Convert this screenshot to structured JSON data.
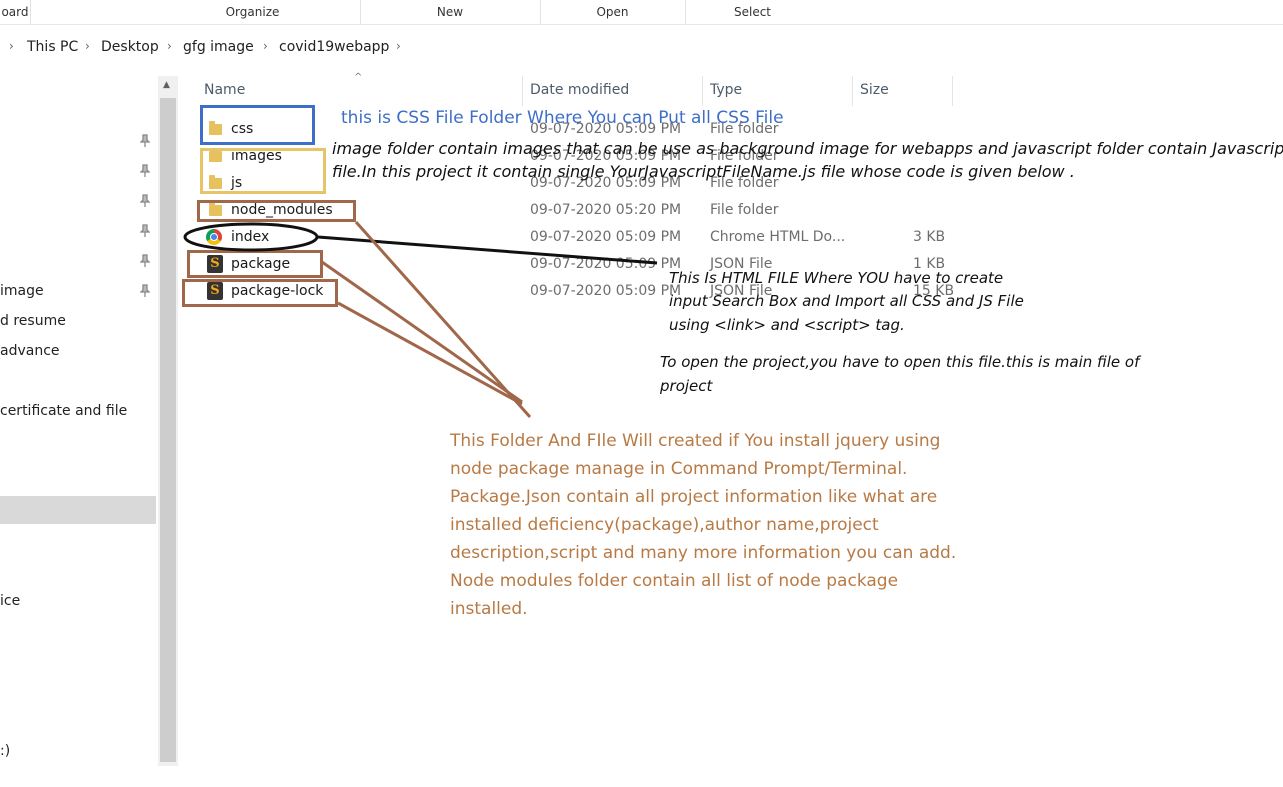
{
  "ribbon": {
    "groups": [
      "oard",
      "Organize",
      "New",
      "Open",
      "Select"
    ]
  },
  "address": {
    "crumbs": [
      "This PC",
      "Desktop",
      "gfg image",
      "covid19webapp"
    ]
  },
  "sidebar": {
    "items": [
      "image",
      "d resume",
      "advance",
      "certificate and file",
      "ice",
      ":)"
    ]
  },
  "columns": {
    "name": "Name",
    "date": "Date modified",
    "type": "Type",
    "size": "Size"
  },
  "files": [
    {
      "name": "css",
      "date": "09-07-2020 05:09 PM",
      "type": "File folder",
      "size": "",
      "icon": "folder-icon"
    },
    {
      "name": "images",
      "date": "09-07-2020 05:09 PM",
      "type": "File folder",
      "size": "",
      "icon": "folder-icon"
    },
    {
      "name": "js",
      "date": "09-07-2020 05:09 PM",
      "type": "File folder",
      "size": "",
      "icon": "folder-icon"
    },
    {
      "name": "node_modules",
      "date": "09-07-2020 05:20 PM",
      "type": "File folder",
      "size": "",
      "icon": "folder-icon"
    },
    {
      "name": "index",
      "date": "09-07-2020 05:09 PM",
      "type": "Chrome HTML Do...",
      "size": "3 KB",
      "icon": "chrome-icon"
    },
    {
      "name": "package",
      "date": "09-07-2020 05:09 PM",
      "type": "JSON File",
      "size": "1 KB",
      "icon": "json-file-icon"
    },
    {
      "name": "package-lock",
      "date": "09-07-2020 05:09 PM",
      "type": "JSON File",
      "size": "15 KB",
      "icon": "json-file-icon"
    }
  ],
  "annotations": {
    "css_note": "this is CSS File Folder Where You can Put all CSS File",
    "images_note": [
      "image folder contain images that can be use as background image for webapps and javascript folder contain Javascript",
      "file.In this project it contain single YourJavascriptFileName.js file whose code is given below ."
    ],
    "html_note": [
      "This Is HTML FILE Where YOU have to create",
      "input Search Box and Import all CSS and JS File",
      "using <link> and <script> tag."
    ],
    "open_note": [
      "To open the project,you have to open this file.this is main file of",
      "project"
    ],
    "node_note": [
      "This Folder And FIle Will created if You install jquery using",
      "node package manage in Command Prompt/Terminal.",
      "Package.Json contain all project information like what are",
      "installed deficiency(package),author name,project",
      "description,script and many more information you can add.",
      "Node modules folder contain all list of node package",
      "installed."
    ]
  },
  "colors": {
    "css_box": "#3d6ec8",
    "images_box": "#e6c46a",
    "node_box": "#a0674a",
    "index_ellipse": "#111111",
    "node_text": "#b87a45"
  }
}
